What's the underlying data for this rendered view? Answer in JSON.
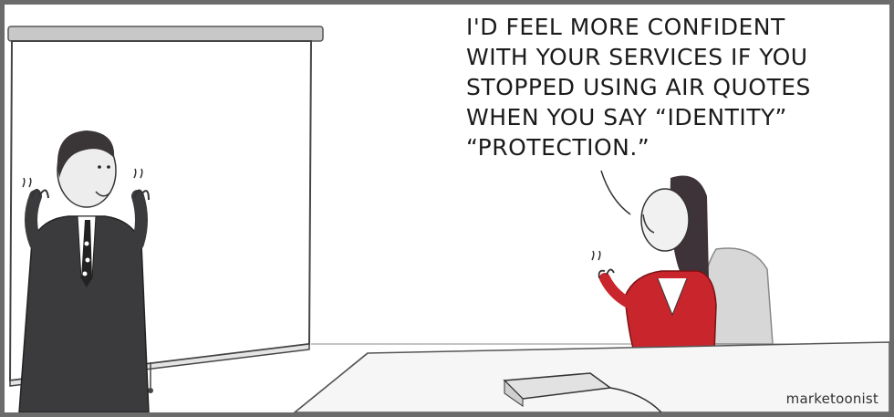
{
  "speech": {
    "lines": [
      "I'D FEEL MORE CONFIDENT",
      "WITH YOUR SERVICES IF YOU",
      "STOPPED USING  AIR QUOTES",
      "WHEN YOU SAY “IDENTITY”",
      "“PROTECTION.”"
    ]
  },
  "watermark": "marketoonist",
  "colors": {
    "border": "#6b6b6b",
    "jacket_red": "#c9252c",
    "suit_dark": "#3a3a3c",
    "hair_dark": "#3d3338",
    "chair_grey": "#d7d7d7",
    "table_white": "#f6f6f6"
  }
}
